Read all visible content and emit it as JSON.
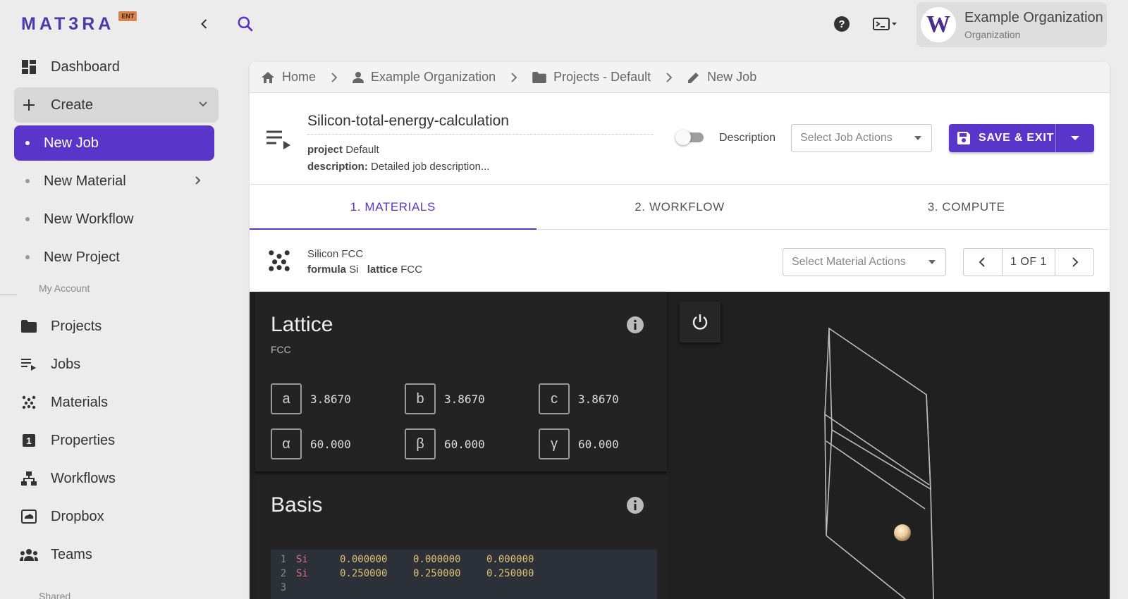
{
  "brand": {
    "logo": "MAT3RA",
    "badge": "ENT"
  },
  "header": {
    "org_name": "Example Organization",
    "org_type": "Organization",
    "org_initial": "W"
  },
  "sidebar": {
    "dashboard": "Dashboard",
    "create": "Create",
    "create_items": [
      "New Job",
      "New Material",
      "New Workflow",
      "New Project"
    ],
    "section_account": "My Account",
    "account_items": [
      "Projects",
      "Jobs",
      "Materials",
      "Properties",
      "Workflows",
      "Dropbox",
      "Teams"
    ],
    "section_shared": "Shared"
  },
  "breadcrumb": [
    "Home",
    "Example Organization",
    "Projects - Default",
    "New Job"
  ],
  "job": {
    "name": "Silicon-total-energy-calculation",
    "project_label": "project",
    "project_value": "Default",
    "description_label": "description:",
    "description_value": "Detailed job description...",
    "toggle_label": "Description",
    "actions_placeholder": "Select Job Actions",
    "save_label": "SAVE & EXIT"
  },
  "tabs": [
    "1. MATERIALS",
    "2. WORKFLOW",
    "3. COMPUTE"
  ],
  "material": {
    "name": "Silicon FCC",
    "formula_label": "formula",
    "formula_value": "Si",
    "lattice_label": "lattice",
    "lattice_value": "FCC",
    "actions_placeholder": "Select Material Actions",
    "pager": "1 OF 1"
  },
  "lattice": {
    "title": "Lattice",
    "type": "FCC",
    "params": [
      {
        "symbol": "a",
        "value": "3.8670"
      },
      {
        "symbol": "b",
        "value": "3.8670"
      },
      {
        "symbol": "c",
        "value": "3.8670"
      },
      {
        "symbol": "α",
        "value": "60.000"
      },
      {
        "symbol": "β",
        "value": "60.000"
      },
      {
        "symbol": "γ",
        "value": "60.000"
      }
    ]
  },
  "basis": {
    "title": "Basis",
    "lines": [
      {
        "n": "1",
        "el": "Si",
        "x": "0.000000",
        "y": "0.000000",
        "z": "0.000000"
      },
      {
        "n": "2",
        "el": "Si",
        "x": "0.250000",
        "y": "0.250000",
        "z": "0.250000"
      },
      {
        "n": "3",
        "el": "",
        "x": "",
        "y": "",
        "z": ""
      }
    ]
  },
  "colors": {
    "accent": "#5a35c9",
    "logo": "#4b3aa7",
    "dark_bg": "#202020"
  },
  "icons": [
    "chevron-left-icon",
    "search-icon",
    "help-icon",
    "terminal-icon",
    "dashboard-icon",
    "plus-icon",
    "chevron-down-icon",
    "folder-icon",
    "jobs-icon",
    "materials-icon",
    "properties-icon",
    "workflows-icon",
    "dropbox-icon",
    "teams-icon",
    "home-icon",
    "person-icon",
    "pencil-icon",
    "save-icon",
    "info-icon",
    "power-icon"
  ]
}
